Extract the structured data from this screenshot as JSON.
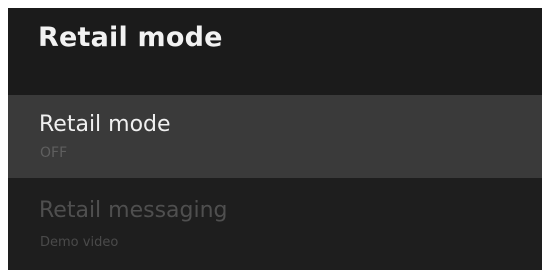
{
  "header": {
    "title": "Retail mode"
  },
  "settings": [
    {
      "title": "Retail mode",
      "value": "OFF",
      "state": "focused"
    },
    {
      "title": "Retail messaging",
      "value": "Demo video",
      "state": "disabled"
    }
  ],
  "colors": {
    "background": "#1e1e1e",
    "header_background": "#1b1b1b",
    "focused_row": "#3a3a3a",
    "primary_text": "#f0f0f0",
    "disabled_text": "#4f4f4f"
  }
}
